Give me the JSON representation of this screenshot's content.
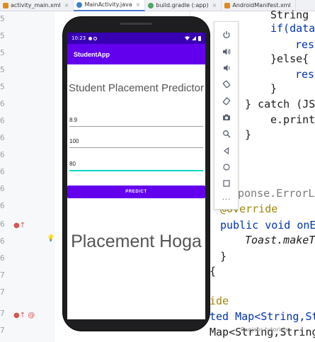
{
  "ide": {
    "tabs": [
      {
        "label": "activity_main.xml",
        "color": "#e08a1e",
        "active": false
      },
      {
        "label": "MainActivity.java",
        "color": "#3b82c4",
        "active": true
      },
      {
        "label": "build.gradle (:app)",
        "color": "#52a36b",
        "active": false
      },
      {
        "label": "AndroidManifest.xml",
        "color": "#e08a1e",
        "active": false
      }
    ],
    "tab_close": "×",
    "line_numbers": [
      "5",
      "5",
      "5",
      "5",
      "5",
      "6",
      "6",
      "6",
      "6",
      "6",
      "6",
      "6",
      "6",
      "6",
      "6",
      "7",
      "7",
      "7",
      "7"
    ],
    "gutter_marks": {
      "override": "●↑",
      "bulb": "💡",
      "at": "●↑ @"
    },
    "code_lines": [
      {
        "text": "String"
      },
      {
        "text": "if(data"
      },
      {
        "text": "res"
      },
      {
        "text": "}else{"
      },
      {
        "text": "res"
      },
      {
        "text": "}"
      },
      {
        "text": "} catch (JS"
      },
      {
        "text": "e.print"
      },
      {
        "text": "}"
      },
      {
        "text": "ponse.ErrorL"
      },
      {
        "text": "@Override"
      },
      {
        "text": "public void onE"
      },
      {
        "text": "Toast.makeT"
      },
      {
        "text": "}"
      },
      {
        "text": "{"
      },
      {
        "text": "ide"
      },
      {
        "text": "ted Map<String,St"
      },
      {
        "text": "Map<String,String>"
      }
    ]
  },
  "emulator_toolbar": {
    "buttons": [
      "power-icon",
      "volume-up-icon",
      "volume-down-icon",
      "rotate-left-icon",
      "rotate-right-icon",
      "camera-icon",
      "zoom-icon",
      "back-icon",
      "home-icon",
      "overview-icon"
    ],
    "more": "···"
  },
  "phone": {
    "status_time": "10:23",
    "app_title": "StudentApp",
    "headline": "Student Placement Predictor",
    "fields": [
      {
        "value": "8.9",
        "focused": false
      },
      {
        "value": "100",
        "focused": false
      },
      {
        "value": "80",
        "focused": true
      }
    ],
    "predict_label": "PREDICT",
    "result_text": "Placement Hoga",
    "nav": {
      "back": "◀",
      "home": "●",
      "recents": "■"
    }
  },
  "watermark": "Ranjans tutorials"
}
